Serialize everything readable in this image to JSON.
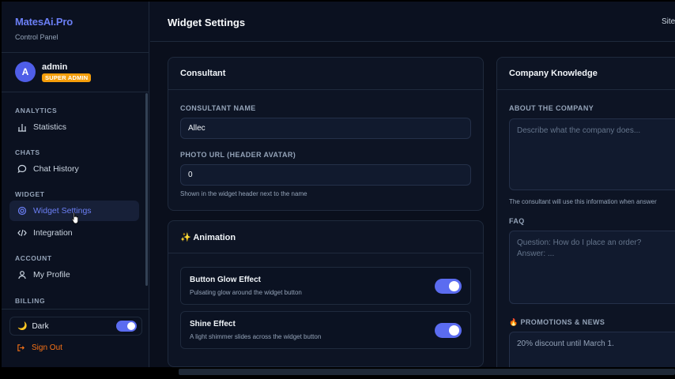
{
  "brand": {
    "name": "MatesAi.Pro",
    "subtitle": "Control Panel"
  },
  "user": {
    "initial": "A",
    "name": "admin",
    "role_badge": "SUPER ADMIN"
  },
  "nav": {
    "sections": [
      {
        "title": "ANALYTICS",
        "items": [
          {
            "label": "Statistics",
            "icon": "bar-chart-icon"
          }
        ]
      },
      {
        "title": "CHATS",
        "items": [
          {
            "label": "Chat History",
            "icon": "chat-bubble-icon"
          }
        ]
      },
      {
        "title": "WIDGET",
        "items": [
          {
            "label": "Widget Settings",
            "icon": "gear-icon",
            "active": true
          },
          {
            "label": "Integration",
            "icon": "code-icon"
          }
        ]
      },
      {
        "title": "ACCOUNT",
        "items": [
          {
            "label": "My Profile",
            "icon": "user-icon"
          }
        ]
      },
      {
        "title": "BILLING",
        "items": []
      }
    ]
  },
  "theme": {
    "label": "Dark",
    "enabled": true
  },
  "signout_label": "Sign Out",
  "header": {
    "title": "Widget Settings",
    "right_link": "Site"
  },
  "consultant": {
    "title": "Consultant",
    "name_label": "CONSULTANT NAME",
    "name_value": "Allec",
    "photo_label": "PHOTO URL (HEADER AVATAR)",
    "photo_value": "0",
    "photo_hint": "Shown in the widget header next to the name"
  },
  "animation": {
    "title": "✨ Animation",
    "items": [
      {
        "title": "Button Glow Effect",
        "desc": "Pulsating glow around the widget button",
        "enabled": true
      },
      {
        "title": "Shine Effect",
        "desc": "A light shimmer slides across the widget button",
        "enabled": true
      }
    ]
  },
  "knowledge": {
    "title": "Company Knowledge",
    "about_label": "ABOUT THE COMPANY",
    "about_placeholder": "Describe what the company does...",
    "about_hint": "The consultant will use this information when answer",
    "faq_label": "FAQ",
    "faq_placeholder": "Question: How do I place an order?\nAnswer: ...",
    "promo_label": "🔥 PROMOTIONS & NEWS",
    "promo_placeholder": "20% discount until March 1."
  },
  "colors": {
    "accent": "#5b6cf0",
    "badge": "#f59e0b",
    "signout": "#f97316"
  }
}
